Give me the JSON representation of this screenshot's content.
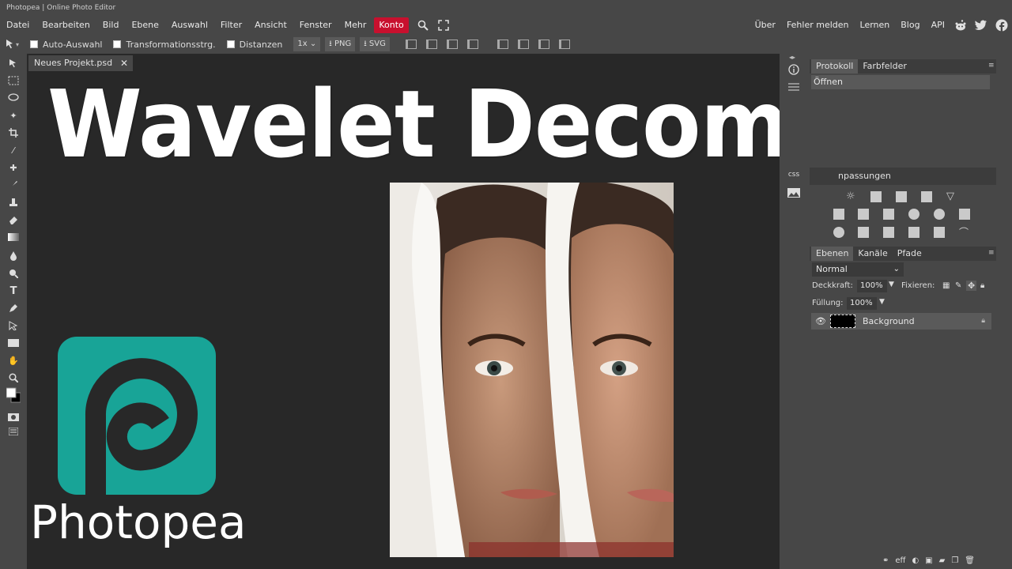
{
  "window_title": "Photopea | Online Photo Editor",
  "menu": {
    "items": [
      "Datei",
      "Bearbeiten",
      "Bild",
      "Ebene",
      "Auswahl",
      "Filter",
      "Ansicht",
      "Fenster",
      "Mehr"
    ],
    "konto": "Konto",
    "right_items": [
      "Über",
      "Fehler melden",
      "Lernen",
      "Blog",
      "API"
    ],
    "social_icons": [
      "reddit-icon",
      "twitter-icon",
      "facebook-icon"
    ]
  },
  "options": {
    "auto_select": "Auto-Auswahl",
    "transform": "Transformationsstrg.",
    "distances": "Distanzen",
    "zoom": "1x",
    "png": "PNG",
    "svg": "SVG"
  },
  "document": {
    "tab_name": "Neues Projekt.psd",
    "close": "✕"
  },
  "overlay": {
    "title": "Wavelet Decompose",
    "logo_word": "Photopea"
  },
  "panels": {
    "history_tabs": [
      "Protokoll",
      "Farbfelder"
    ],
    "history_items": [
      "Öffnen"
    ],
    "adjustments_label": "npassungen",
    "layers_tabs": [
      "Ebenen",
      "Kanäle",
      "Pfade"
    ],
    "blend_mode": "Normal",
    "opacity_label": "Deckkraft:",
    "opacity_value": "100%",
    "lock_label": "Fixieren:",
    "fill_label": "Füllung:",
    "fill_value": "100%",
    "layers": [
      {
        "name": "Background"
      }
    ],
    "bottom_icons": [
      "link-icon",
      "eff",
      "mask-icon",
      "adjust-icon",
      "folder-icon",
      "new-layer-icon",
      "trash-icon"
    ]
  },
  "colors": {
    "accent_konto": "#c8102e",
    "logo_teal": "#18a497",
    "canvas_bg": "#282828",
    "ui_bg": "#474747"
  }
}
